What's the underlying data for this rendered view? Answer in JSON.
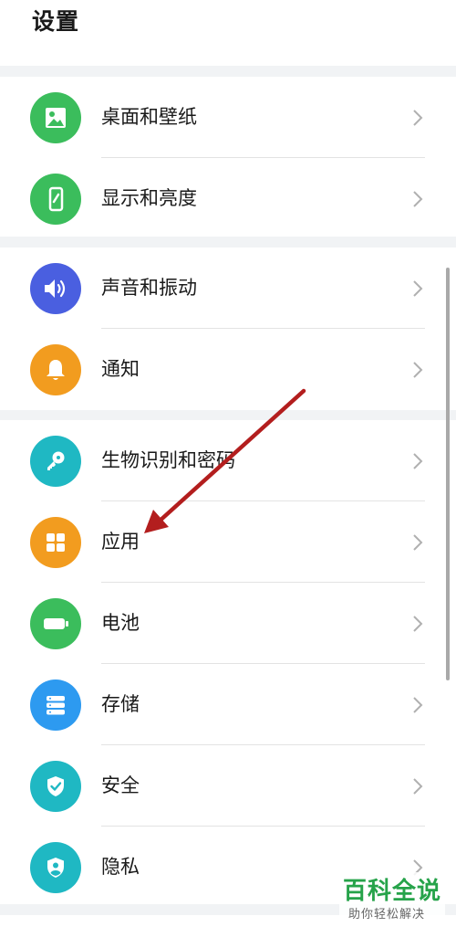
{
  "header": {
    "title": "设置"
  },
  "groups": [
    {
      "items": [
        {
          "label": "桌面和壁纸",
          "icon": "wallpaper-icon",
          "color": "#3bbd5c"
        },
        {
          "label": "显示和亮度",
          "icon": "display-brightness-icon",
          "color": "#3bbd5c"
        }
      ]
    },
    {
      "items": [
        {
          "label": "声音和振动",
          "icon": "sound-icon",
          "color": "#4a5fe0"
        },
        {
          "label": "通知",
          "icon": "bell-icon",
          "color": "#f29c1f"
        }
      ]
    },
    {
      "items": [
        {
          "label": "生物识别和密码",
          "icon": "key-icon",
          "color": "#1fb8c3"
        },
        {
          "label": "应用",
          "icon": "apps-grid-icon",
          "color": "#f29c1f"
        },
        {
          "label": "电池",
          "icon": "battery-icon",
          "color": "#3bbd5c"
        },
        {
          "label": "存储",
          "icon": "storage-icon",
          "color": "#2d9af0"
        },
        {
          "label": "安全",
          "icon": "shield-check-icon",
          "color": "#1fb8c3"
        },
        {
          "label": "隐私",
          "icon": "privacy-icon",
          "color": "#1fb8c3"
        }
      ]
    }
  ],
  "annotation": {
    "arrow_color": "#b31e1e"
  },
  "watermark": {
    "title": "百科全说",
    "subtitle": "助你轻松解决",
    "color": "#26a34a"
  }
}
